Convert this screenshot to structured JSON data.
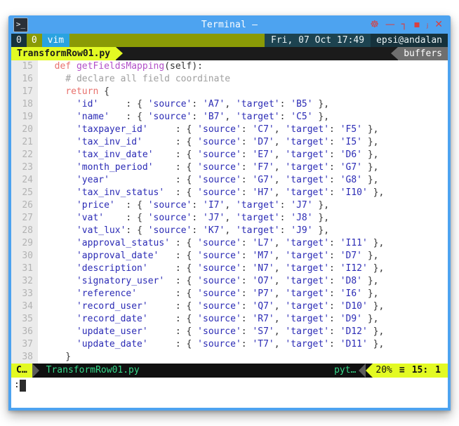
{
  "window": {
    "title": "Terminal –",
    "icon": "terminal-prompt-icon",
    "buttons": [
      {
        "name": "settings-icon",
        "glyph": "☸"
      },
      {
        "name": "minimize-icon",
        "glyph": "—"
      },
      {
        "name": "maximize-icon",
        "glyph": "┐"
      },
      {
        "name": "dot-icon",
        "glyph": "▪"
      },
      {
        "name": "shade-icon",
        "glyph": "ⱼ"
      },
      {
        "name": "close-icon",
        "glyph": "✕"
      }
    ],
    "border_color": "#4da3f0"
  },
  "tmux": {
    "session_index": "0",
    "window_index": "0",
    "window_name": "vim",
    "datetime": "Fri, 07 Oct 17:49",
    "user_host": "epsi@andalan",
    "tab_file": "TransformRow01.py",
    "buffers_label": "buffers",
    "accent_green": "#8a9a06",
    "accent_yellow": "#e3fa23",
    "accent_blue": "#2aa3e0"
  },
  "editor": {
    "first_line_number": 15,
    "lines": [
      {
        "num": "15",
        "tokens": [
          {
            "t": "  ",
            "c": "pn"
          },
          {
            "t": "def ",
            "c": "k"
          },
          {
            "t": "getFieldsMapping",
            "c": "fn"
          },
          {
            "t": "(",
            "c": "pn"
          },
          {
            "t": "self",
            "c": "id"
          },
          {
            "t": "):",
            "c": "pn"
          }
        ]
      },
      {
        "num": "16",
        "tokens": [
          {
            "t": "    # declare all field coordinate",
            "c": "cm"
          }
        ]
      },
      {
        "num": "17",
        "tokens": [
          {
            "t": "    ",
            "c": "pn"
          },
          {
            "t": "return",
            "c": "k"
          },
          {
            "t": " {",
            "c": "pn"
          }
        ]
      },
      {
        "num": "18",
        "tokens": [
          {
            "t": "      ",
            "c": "pn"
          },
          {
            "t": "'id'",
            "c": "st"
          },
          {
            "t": "     : { ",
            "c": "pn"
          },
          {
            "t": "'source'",
            "c": "st"
          },
          {
            "t": ": ",
            "c": "pn"
          },
          {
            "t": "'A7'",
            "c": "st"
          },
          {
            "t": ", ",
            "c": "pn"
          },
          {
            "t": "'target'",
            "c": "st"
          },
          {
            "t": ": ",
            "c": "pn"
          },
          {
            "t": "'B5'",
            "c": "st"
          },
          {
            "t": " },",
            "c": "pn"
          }
        ]
      },
      {
        "num": "19",
        "tokens": [
          {
            "t": "      ",
            "c": "pn"
          },
          {
            "t": "'name'",
            "c": "st"
          },
          {
            "t": "   : { ",
            "c": "pn"
          },
          {
            "t": "'source'",
            "c": "st"
          },
          {
            "t": ": ",
            "c": "pn"
          },
          {
            "t": "'B7'",
            "c": "st"
          },
          {
            "t": ", ",
            "c": "pn"
          },
          {
            "t": "'target'",
            "c": "st"
          },
          {
            "t": ": ",
            "c": "pn"
          },
          {
            "t": "'C5'",
            "c": "st"
          },
          {
            "t": " },",
            "c": "pn"
          }
        ]
      },
      {
        "num": "20",
        "tokens": [
          {
            "t": "      ",
            "c": "pn"
          },
          {
            "t": "'taxpayer_id'",
            "c": "st"
          },
          {
            "t": "     : { ",
            "c": "pn"
          },
          {
            "t": "'source'",
            "c": "st"
          },
          {
            "t": ": ",
            "c": "pn"
          },
          {
            "t": "'C7'",
            "c": "st"
          },
          {
            "t": ", ",
            "c": "pn"
          },
          {
            "t": "'target'",
            "c": "st"
          },
          {
            "t": ": ",
            "c": "pn"
          },
          {
            "t": "'F5'",
            "c": "st"
          },
          {
            "t": " },",
            "c": "pn"
          }
        ]
      },
      {
        "num": "21",
        "tokens": [
          {
            "t": "      ",
            "c": "pn"
          },
          {
            "t": "'tax_inv_id'",
            "c": "st"
          },
          {
            "t": "      : { ",
            "c": "pn"
          },
          {
            "t": "'source'",
            "c": "st"
          },
          {
            "t": ": ",
            "c": "pn"
          },
          {
            "t": "'D7'",
            "c": "st"
          },
          {
            "t": ", ",
            "c": "pn"
          },
          {
            "t": "'target'",
            "c": "st"
          },
          {
            "t": ": ",
            "c": "pn"
          },
          {
            "t": "'I5'",
            "c": "st"
          },
          {
            "t": " },",
            "c": "pn"
          }
        ]
      },
      {
        "num": "22",
        "tokens": [
          {
            "t": "      ",
            "c": "pn"
          },
          {
            "t": "'tax_inv_date'",
            "c": "st"
          },
          {
            "t": "    : { ",
            "c": "pn"
          },
          {
            "t": "'source'",
            "c": "st"
          },
          {
            "t": ": ",
            "c": "pn"
          },
          {
            "t": "'E7'",
            "c": "st"
          },
          {
            "t": ", ",
            "c": "pn"
          },
          {
            "t": "'target'",
            "c": "st"
          },
          {
            "t": ": ",
            "c": "pn"
          },
          {
            "t": "'D6'",
            "c": "st"
          },
          {
            "t": " },",
            "c": "pn"
          }
        ]
      },
      {
        "num": "23",
        "tokens": [
          {
            "t": "      ",
            "c": "pn"
          },
          {
            "t": "'month_period'",
            "c": "st"
          },
          {
            "t": "    : { ",
            "c": "pn"
          },
          {
            "t": "'source'",
            "c": "st"
          },
          {
            "t": ": ",
            "c": "pn"
          },
          {
            "t": "'F7'",
            "c": "st"
          },
          {
            "t": ", ",
            "c": "pn"
          },
          {
            "t": "'target'",
            "c": "st"
          },
          {
            "t": ": ",
            "c": "pn"
          },
          {
            "t": "'G7'",
            "c": "st"
          },
          {
            "t": " },",
            "c": "pn"
          }
        ]
      },
      {
        "num": "24",
        "tokens": [
          {
            "t": "      ",
            "c": "pn"
          },
          {
            "t": "'year'",
            "c": "st"
          },
          {
            "t": "            : { ",
            "c": "pn"
          },
          {
            "t": "'source'",
            "c": "st"
          },
          {
            "t": ": ",
            "c": "pn"
          },
          {
            "t": "'G7'",
            "c": "st"
          },
          {
            "t": ", ",
            "c": "pn"
          },
          {
            "t": "'target'",
            "c": "st"
          },
          {
            "t": ": ",
            "c": "pn"
          },
          {
            "t": "'G8'",
            "c": "st"
          },
          {
            "t": " },",
            "c": "pn"
          }
        ]
      },
      {
        "num": "25",
        "tokens": [
          {
            "t": "      ",
            "c": "pn"
          },
          {
            "t": "'tax_inv_status'",
            "c": "st"
          },
          {
            "t": "  : { ",
            "c": "pn"
          },
          {
            "t": "'source'",
            "c": "st"
          },
          {
            "t": ": ",
            "c": "pn"
          },
          {
            "t": "'H7'",
            "c": "st"
          },
          {
            "t": ", ",
            "c": "pn"
          },
          {
            "t": "'target'",
            "c": "st"
          },
          {
            "t": ": ",
            "c": "pn"
          },
          {
            "t": "'I10'",
            "c": "st"
          },
          {
            "t": " },",
            "c": "pn"
          }
        ]
      },
      {
        "num": "26",
        "tokens": [
          {
            "t": "      ",
            "c": "pn"
          },
          {
            "t": "'price'",
            "c": "st"
          },
          {
            "t": "  : { ",
            "c": "pn"
          },
          {
            "t": "'source'",
            "c": "st"
          },
          {
            "t": ": ",
            "c": "pn"
          },
          {
            "t": "'I7'",
            "c": "st"
          },
          {
            "t": ", ",
            "c": "pn"
          },
          {
            "t": "'target'",
            "c": "st"
          },
          {
            "t": ": ",
            "c": "pn"
          },
          {
            "t": "'J7'",
            "c": "st"
          },
          {
            "t": " },",
            "c": "pn"
          }
        ]
      },
      {
        "num": "27",
        "tokens": [
          {
            "t": "      ",
            "c": "pn"
          },
          {
            "t": "'vat'",
            "c": "st"
          },
          {
            "t": "    : { ",
            "c": "pn"
          },
          {
            "t": "'source'",
            "c": "st"
          },
          {
            "t": ": ",
            "c": "pn"
          },
          {
            "t": "'J7'",
            "c": "st"
          },
          {
            "t": ", ",
            "c": "pn"
          },
          {
            "t": "'target'",
            "c": "st"
          },
          {
            "t": ": ",
            "c": "pn"
          },
          {
            "t": "'J8'",
            "c": "st"
          },
          {
            "t": " },",
            "c": "pn"
          }
        ]
      },
      {
        "num": "28",
        "tokens": [
          {
            "t": "      ",
            "c": "pn"
          },
          {
            "t": "'vat_lux'",
            "c": "st"
          },
          {
            "t": ": { ",
            "c": "pn"
          },
          {
            "t": "'source'",
            "c": "st"
          },
          {
            "t": ": ",
            "c": "pn"
          },
          {
            "t": "'K7'",
            "c": "st"
          },
          {
            "t": ", ",
            "c": "pn"
          },
          {
            "t": "'target'",
            "c": "st"
          },
          {
            "t": ": ",
            "c": "pn"
          },
          {
            "t": "'J9'",
            "c": "st"
          },
          {
            "t": " },",
            "c": "pn"
          }
        ]
      },
      {
        "num": "29",
        "tokens": [
          {
            "t": "      ",
            "c": "pn"
          },
          {
            "t": "'approval_status'",
            "c": "st"
          },
          {
            "t": " : { ",
            "c": "pn"
          },
          {
            "t": "'source'",
            "c": "st"
          },
          {
            "t": ": ",
            "c": "pn"
          },
          {
            "t": "'L7'",
            "c": "st"
          },
          {
            "t": ", ",
            "c": "pn"
          },
          {
            "t": "'target'",
            "c": "st"
          },
          {
            "t": ": ",
            "c": "pn"
          },
          {
            "t": "'I11'",
            "c": "st"
          },
          {
            "t": " },",
            "c": "pn"
          }
        ]
      },
      {
        "num": "30",
        "tokens": [
          {
            "t": "      ",
            "c": "pn"
          },
          {
            "t": "'approval_date'",
            "c": "st"
          },
          {
            "t": "   : { ",
            "c": "pn"
          },
          {
            "t": "'source'",
            "c": "st"
          },
          {
            "t": ": ",
            "c": "pn"
          },
          {
            "t": "'M7'",
            "c": "st"
          },
          {
            "t": ", ",
            "c": "pn"
          },
          {
            "t": "'target'",
            "c": "st"
          },
          {
            "t": ": ",
            "c": "pn"
          },
          {
            "t": "'D7'",
            "c": "st"
          },
          {
            "t": " },",
            "c": "pn"
          }
        ]
      },
      {
        "num": "31",
        "tokens": [
          {
            "t": "      ",
            "c": "pn"
          },
          {
            "t": "'description'",
            "c": "st"
          },
          {
            "t": "     : { ",
            "c": "pn"
          },
          {
            "t": "'source'",
            "c": "st"
          },
          {
            "t": ": ",
            "c": "pn"
          },
          {
            "t": "'N7'",
            "c": "st"
          },
          {
            "t": ", ",
            "c": "pn"
          },
          {
            "t": "'target'",
            "c": "st"
          },
          {
            "t": ": ",
            "c": "pn"
          },
          {
            "t": "'I12'",
            "c": "st"
          },
          {
            "t": " },",
            "c": "pn"
          }
        ]
      },
      {
        "num": "32",
        "tokens": [
          {
            "t": "      ",
            "c": "pn"
          },
          {
            "t": "'signatory_user'",
            "c": "st"
          },
          {
            "t": "  : { ",
            "c": "pn"
          },
          {
            "t": "'source'",
            "c": "st"
          },
          {
            "t": ": ",
            "c": "pn"
          },
          {
            "t": "'O7'",
            "c": "st"
          },
          {
            "t": ", ",
            "c": "pn"
          },
          {
            "t": "'target'",
            "c": "st"
          },
          {
            "t": ": ",
            "c": "pn"
          },
          {
            "t": "'D8'",
            "c": "st"
          },
          {
            "t": " },",
            "c": "pn"
          }
        ]
      },
      {
        "num": "33",
        "tokens": [
          {
            "t": "      ",
            "c": "pn"
          },
          {
            "t": "'reference'",
            "c": "st"
          },
          {
            "t": "       : { ",
            "c": "pn"
          },
          {
            "t": "'source'",
            "c": "st"
          },
          {
            "t": ": ",
            "c": "pn"
          },
          {
            "t": "'P7'",
            "c": "st"
          },
          {
            "t": ", ",
            "c": "pn"
          },
          {
            "t": "'target'",
            "c": "st"
          },
          {
            "t": ": ",
            "c": "pn"
          },
          {
            "t": "'I6'",
            "c": "st"
          },
          {
            "t": " },",
            "c": "pn"
          }
        ]
      },
      {
        "num": "34",
        "tokens": [
          {
            "t": "      ",
            "c": "pn"
          },
          {
            "t": "'record_user'",
            "c": "st"
          },
          {
            "t": "     : { ",
            "c": "pn"
          },
          {
            "t": "'source'",
            "c": "st"
          },
          {
            "t": ": ",
            "c": "pn"
          },
          {
            "t": "'Q7'",
            "c": "st"
          },
          {
            "t": ", ",
            "c": "pn"
          },
          {
            "t": "'target'",
            "c": "st"
          },
          {
            "t": ": ",
            "c": "pn"
          },
          {
            "t": "'D10'",
            "c": "st"
          },
          {
            "t": " },",
            "c": "pn"
          }
        ]
      },
      {
        "num": "35",
        "tokens": [
          {
            "t": "      ",
            "c": "pn"
          },
          {
            "t": "'record_date'",
            "c": "st"
          },
          {
            "t": "     : { ",
            "c": "pn"
          },
          {
            "t": "'source'",
            "c": "st"
          },
          {
            "t": ": ",
            "c": "pn"
          },
          {
            "t": "'R7'",
            "c": "st"
          },
          {
            "t": ", ",
            "c": "pn"
          },
          {
            "t": "'target'",
            "c": "st"
          },
          {
            "t": ": ",
            "c": "pn"
          },
          {
            "t": "'D9'",
            "c": "st"
          },
          {
            "t": " },",
            "c": "pn"
          }
        ]
      },
      {
        "num": "36",
        "tokens": [
          {
            "t": "      ",
            "c": "pn"
          },
          {
            "t": "'update_user'",
            "c": "st"
          },
          {
            "t": "     : { ",
            "c": "pn"
          },
          {
            "t": "'source'",
            "c": "st"
          },
          {
            "t": ": ",
            "c": "pn"
          },
          {
            "t": "'S7'",
            "c": "st"
          },
          {
            "t": ", ",
            "c": "pn"
          },
          {
            "t": "'target'",
            "c": "st"
          },
          {
            "t": ": ",
            "c": "pn"
          },
          {
            "t": "'D12'",
            "c": "st"
          },
          {
            "t": " },",
            "c": "pn"
          }
        ]
      },
      {
        "num": "37",
        "tokens": [
          {
            "t": "      ",
            "c": "pn"
          },
          {
            "t": "'update_date'",
            "c": "st"
          },
          {
            "t": "     : { ",
            "c": "pn"
          },
          {
            "t": "'source'",
            "c": "st"
          },
          {
            "t": ": ",
            "c": "pn"
          },
          {
            "t": "'T7'",
            "c": "st"
          },
          {
            "t": ", ",
            "c": "pn"
          },
          {
            "t": "'target'",
            "c": "st"
          },
          {
            "t": ": ",
            "c": "pn"
          },
          {
            "t": "'D11'",
            "c": "st"
          },
          {
            "t": " },",
            "c": "pn"
          }
        ]
      },
      {
        "num": "38",
        "tokens": [
          {
            "t": "    }",
            "c": "pn"
          }
        ]
      }
    ]
  },
  "statusline": {
    "mode": "C…",
    "filename": "TransformRow01.py",
    "filetype": "pyt…",
    "percent": "20%",
    "list_icon": "≡",
    "line": "15:",
    "col": "1"
  },
  "cmdline": {
    "prompt": ":"
  }
}
